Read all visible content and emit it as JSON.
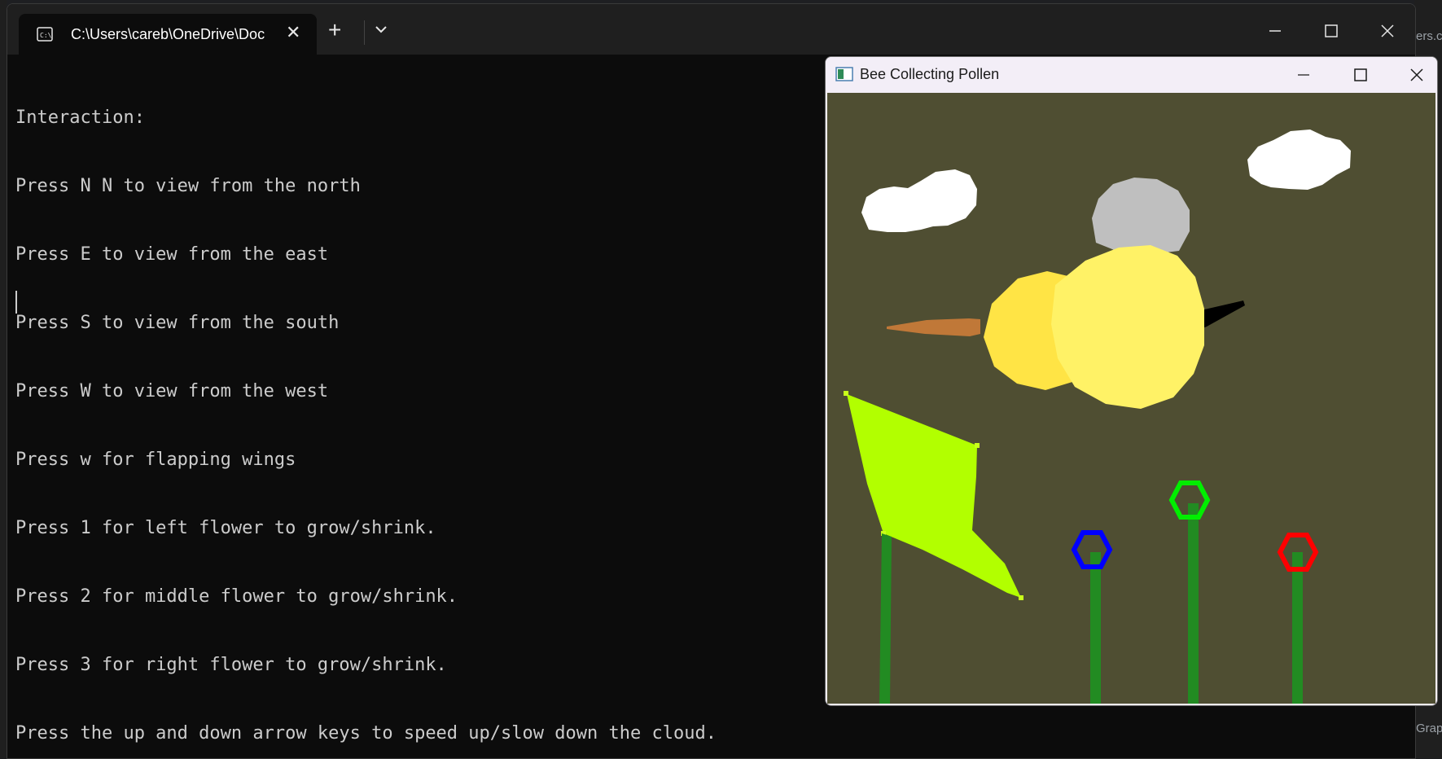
{
  "terminal": {
    "tab_title": "C:\\Users\\careb\\OneDrive\\Doc",
    "new_tab_label": "+",
    "close_tab_label": "✕",
    "lines": [
      "Interaction:",
      "Press N N to view from the north",
      "Press E to view from the east",
      "Press S to view from the south",
      "Press W to view from the west",
      "Press w for flapping wings",
      "Press 1 for left flower to grow/shrink.",
      "Press 2 for middle flower to grow/shrink.",
      "Press 3 for right flower to grow/shrink.",
      "Press the up and down arrow keys to speed up/slow down the cloud."
    ]
  },
  "gl_window": {
    "title": "Bee Collecting Pollen"
  },
  "background_fragments": {
    "right_top": "ers.c",
    "right_bottom": "Grap"
  },
  "colors": {
    "scene_background": "#4f4e32",
    "cloud": "#ffffff",
    "bee_body": "#fff266",
    "bee_head": "#ffe445",
    "bee_wing": "#bfbfbf",
    "stinger": "#000000",
    "pollen_tool": "#c07838",
    "leaf": "#b2ff00",
    "stem": "#228b22",
    "flower_left": "#0000ff",
    "flower_middle": "#00ee00",
    "flower_right": "#ff0000"
  }
}
